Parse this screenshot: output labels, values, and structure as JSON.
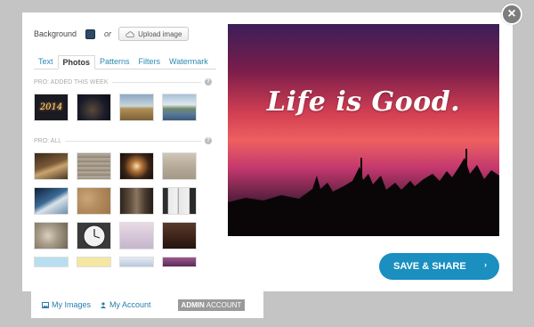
{
  "modal": {
    "close_label": "×",
    "background_label": "Background",
    "background_color": "#2e4a66",
    "or_label": "or",
    "upload_label": "Upload image"
  },
  "tabs": [
    {
      "label": "Text",
      "active": false
    },
    {
      "label": "Photos",
      "active": true
    },
    {
      "label": "Patterns",
      "active": false
    },
    {
      "label": "Filters",
      "active": false
    },
    {
      "label": "Watermark",
      "active": false
    }
  ],
  "sections": {
    "recent_title": "PRO: ADDED THIS WEEK",
    "all_title": "PRO: ALL",
    "help_label": "?"
  },
  "preview": {
    "text": "Life is Good."
  },
  "actions": {
    "save_label": "SAVE & SHARE",
    "save_arrow": "›"
  },
  "footer": {
    "my_images": "My Images",
    "my_account": "My Account",
    "admin_bold": "ADMIN",
    "admin_rest": "ACCOUNT"
  },
  "colors": {
    "accent": "#1a8fc0",
    "link": "#2a8bb0"
  }
}
